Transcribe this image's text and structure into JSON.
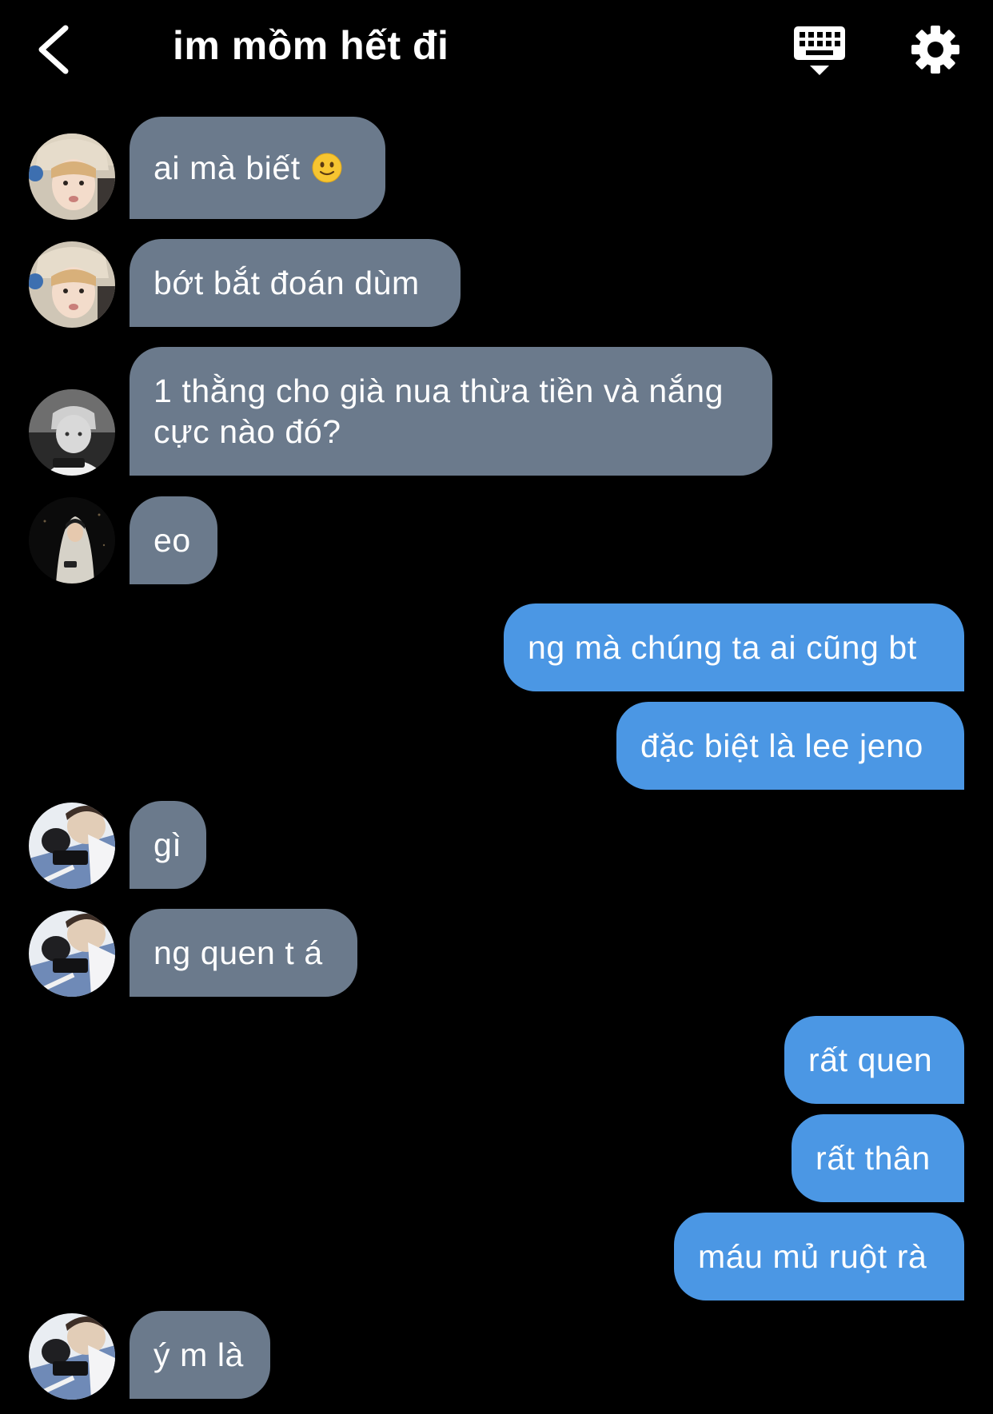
{
  "header": {
    "title": "im mồm hết đi",
    "back_icon": "chevron-left-icon",
    "keyboard_icon": "keyboard-hide-icon",
    "settings_icon": "gear-icon"
  },
  "colors": {
    "background": "#000000",
    "incoming_bubble": "#6b7a8c",
    "outgoing_bubble": "#4b97e4",
    "text": "#ffffff"
  },
  "messages": [
    {
      "side": "in",
      "avatar": "avatar-1",
      "text": "ai mà biết",
      "emoji": "slightly-smiling-face"
    },
    {
      "side": "in",
      "avatar": "avatar-1",
      "text": "bớt bắt đoán dùm"
    },
    {
      "side": "in",
      "avatar": "avatar-2",
      "text": "1 thằng cho già nua thừa tiền và nắng cực nào đó?"
    },
    {
      "side": "in",
      "avatar": "avatar-3",
      "text": "eo"
    },
    {
      "side": "out",
      "text": "ng mà chúng ta ai cũng bt"
    },
    {
      "side": "out",
      "text": "đặc biệt là lee jeno"
    },
    {
      "side": "in",
      "avatar": "avatar-4",
      "text": "gì"
    },
    {
      "side": "in",
      "avatar": "avatar-4",
      "text": "ng quen t á"
    },
    {
      "side": "out",
      "text": "rất quen"
    },
    {
      "side": "out",
      "text": "rất thân"
    },
    {
      "side": "out",
      "text": "máu mủ ruột rà"
    },
    {
      "side": "in",
      "avatar": "avatar-4",
      "text": "ý m là"
    }
  ]
}
